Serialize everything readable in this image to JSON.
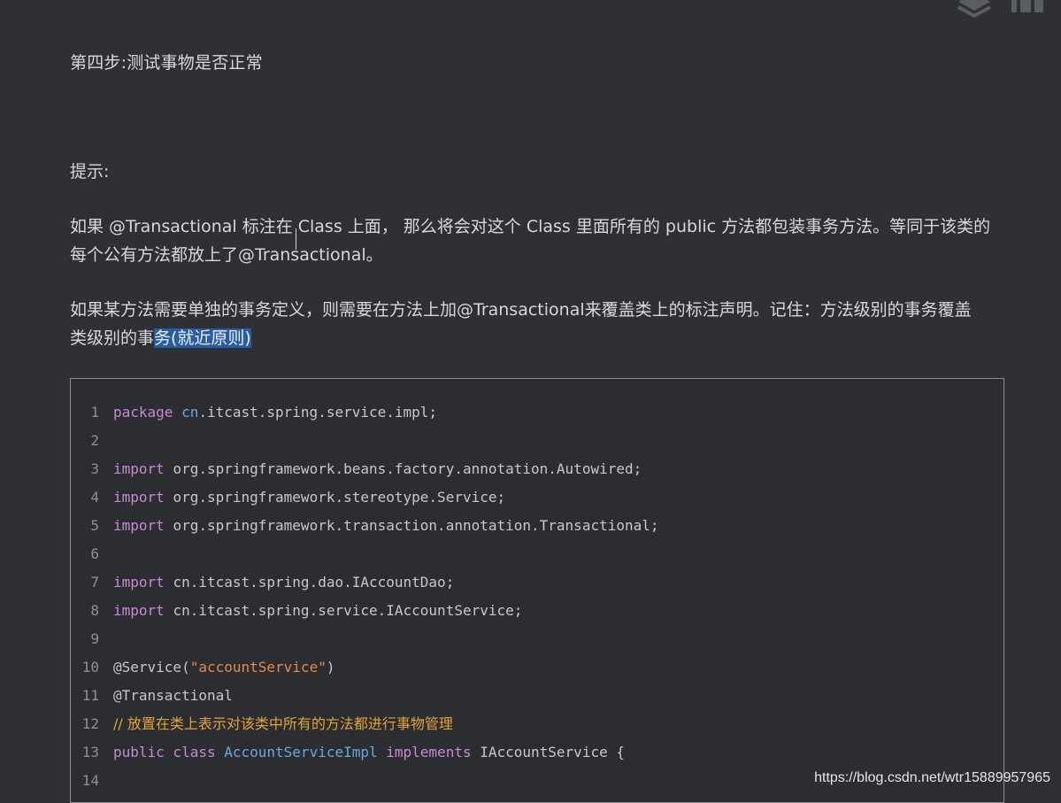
{
  "step_title": "第四步:测试事物是否正常",
  "hint_label": "提示:",
  "paragraph_1": {
    "line_1": "如果 @Transactional 标注在 Class 上面， 那么将会对这个 Class 里面所有的 public 方法都包装事务方法。等同于该类的",
    "line_2": "每个公有方法都放上了@Transactional。"
  },
  "paragraph_2": {
    "line_1": "如果某方法需要单独的事务定义，则需要在方法上加@Transactional来覆盖类上的标注声明。记住：方法级别的事务覆盖",
    "line_2_before": "类级别的事",
    "line_2_highlight": "务(就近原则)"
  },
  "code": {
    "lines": [
      {
        "n": "1",
        "kw": "package ",
        "pkg": "cn",
        "rest": ".itcast.spring.service.impl;"
      },
      {
        "n": "2"
      },
      {
        "n": "3",
        "kw": "import ",
        "rest": "org.springframework.beans.factory.annotation.Autowired;"
      },
      {
        "n": "4",
        "kw": "import ",
        "rest": "org.springframework.stereotype.Service;"
      },
      {
        "n": "5",
        "kw": "import ",
        "rest": "org.springframework.transaction.annotation.Transactional;"
      },
      {
        "n": "6"
      },
      {
        "n": "7",
        "kw": "import ",
        "rest": "cn.itcast.spring.dao.IAccountDao;"
      },
      {
        "n": "8",
        "kw": "import ",
        "rest": "cn.itcast.spring.service.IAccountService;"
      },
      {
        "n": "9"
      },
      {
        "n": "10",
        "pre": "@Service(",
        "str": "\"accountService\"",
        "post": ")"
      },
      {
        "n": "11",
        "pre": "@Transactional"
      },
      {
        "n": "12",
        "comment": "// 放置在类上表示对该类中所有的方法都进行事物管理"
      },
      {
        "n": "13",
        "kw": "public class ",
        "cls": "AccountServiceImpl",
        "kw2": " implements ",
        "rest": "IAccountService {"
      },
      {
        "n": "14"
      }
    ]
  },
  "watermark": "https://blog.csdn.net/wtr15889957965",
  "colors": {
    "background": "#2e3034",
    "keyword": "#c58bd3",
    "type": "#68a8e0",
    "string": "#e5894f",
    "comment": "#e0a33c",
    "selection": "#2a5d9f"
  }
}
